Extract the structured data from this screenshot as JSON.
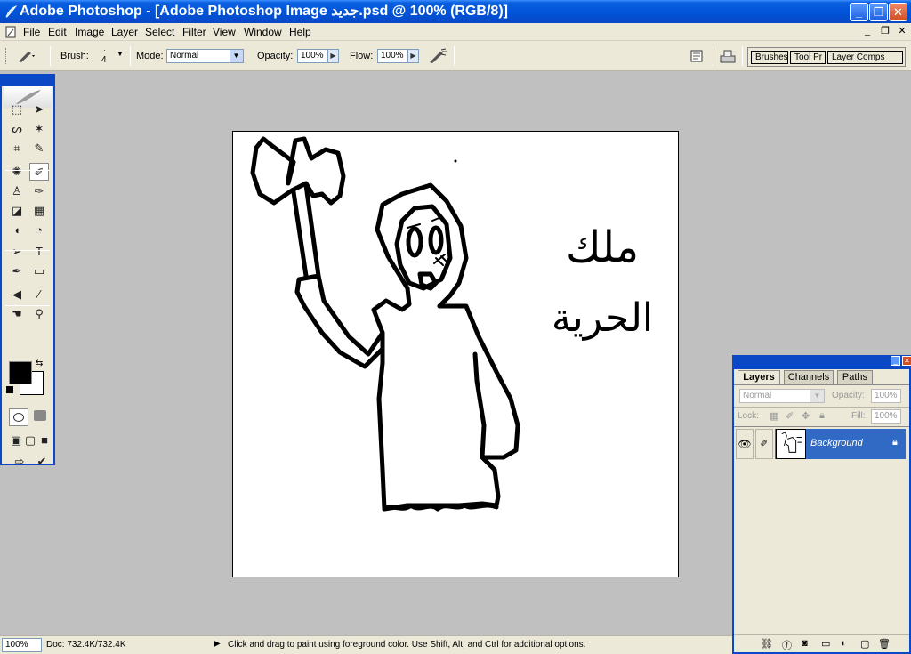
{
  "titlebar": {
    "title": "Adobe Photoshop - [Adobe Photoshop Image جديد.psd @ 100% (RGB/8)]",
    "minimize": "_",
    "restore": "❐",
    "close": "✕"
  },
  "menubar": {
    "items": [
      "File",
      "Edit",
      "Image",
      "Layer",
      "Select",
      "Filter",
      "View",
      "Window",
      "Help"
    ],
    "doc_minimize": "_",
    "doc_restore": "❐",
    "doc_close": "✕"
  },
  "options": {
    "brush_label": "Brush:",
    "brush_size": "4",
    "mode_label": "Mode:",
    "mode_value": "Normal",
    "opacity_label": "Opacity:",
    "opacity_value": "100%",
    "flow_label": "Flow:",
    "flow_value": "100%",
    "palette_well_tabs": [
      "Brushes",
      "Tool Pr",
      "Layer Comps"
    ]
  },
  "toolbox": {
    "tools": [
      {
        "name": "marquee-tool-icon",
        "glyph": "⬚"
      },
      {
        "name": "move-tool-icon",
        "glyph": "➤"
      },
      {
        "name": "lasso-tool-icon",
        "glyph": "ᔕ"
      },
      {
        "name": "magic-wand-tool-icon",
        "glyph": "✶"
      },
      {
        "name": "crop-tool-icon",
        "glyph": "⌗"
      },
      {
        "name": "slice-tool-icon",
        "glyph": "✎"
      },
      {
        "name": "healing-brush-tool-icon",
        "glyph": "✺"
      },
      {
        "name": "brush-tool-icon",
        "glyph": "✐"
      },
      {
        "name": "clone-stamp-tool-icon",
        "glyph": "♙"
      },
      {
        "name": "history-brush-tool-icon",
        "glyph": "✑"
      },
      {
        "name": "eraser-tool-icon",
        "glyph": "◪"
      },
      {
        "name": "gradient-tool-icon",
        "glyph": "▦"
      },
      {
        "name": "blur-tool-icon",
        "glyph": "◖"
      },
      {
        "name": "dodge-tool-icon",
        "glyph": "◔"
      },
      {
        "name": "path-selection-tool-icon",
        "glyph": "➢"
      },
      {
        "name": "type-tool-icon",
        "glyph": "T"
      },
      {
        "name": "pen-tool-icon",
        "glyph": "✒"
      },
      {
        "name": "rectangle-tool-icon",
        "glyph": "▭"
      },
      {
        "name": "notes-tool-icon",
        "glyph": "◀"
      },
      {
        "name": "eyedropper-tool-icon",
        "glyph": "⁄"
      },
      {
        "name": "hand-tool-icon",
        "glyph": "☚"
      },
      {
        "name": "zoom-tool-icon",
        "glyph": "⚲"
      }
    ],
    "foreground_color": "#000000",
    "background_color": "#ffffff"
  },
  "canvas": {
    "background": "#ffffff",
    "text_line1": "ملك",
    "text_line2": "الحرية"
  },
  "layers_panel": {
    "tabs": [
      "Layers",
      "Channels",
      "Paths"
    ],
    "blend_mode": "Normal",
    "opacity_label": "Opacity:",
    "opacity_value": "100%",
    "lock_label": "Lock:",
    "fill_label": "Fill:",
    "fill_value": "100%",
    "layer_name": "Background"
  },
  "statusbar": {
    "zoom": "100%",
    "doc_info": "Doc: 732.4K/732.4K",
    "hint": "Click and drag to paint using foreground color.  Use Shift, Alt, and Ctrl for additional options."
  }
}
